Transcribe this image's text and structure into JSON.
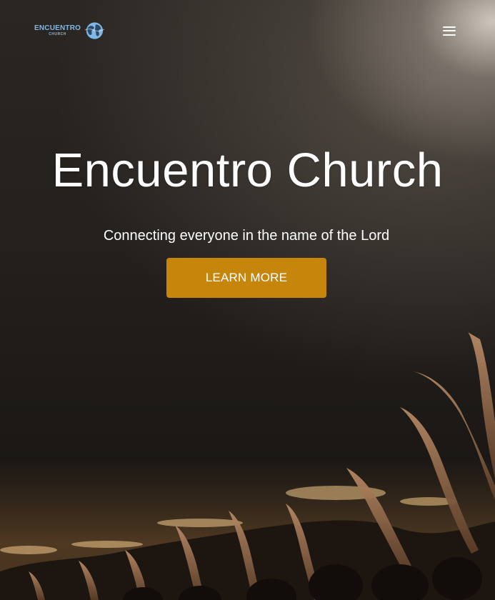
{
  "header": {
    "logo": {
      "main_text": "ENCUENTRO",
      "sub_text": "CHURCH",
      "icon": "globe-icon",
      "color": "#7fb7e6"
    },
    "menu_icon": "hamburger-menu-icon"
  },
  "hero": {
    "title": "Encuentro Church",
    "subtitle": "Connecting everyone in the name of the Lord",
    "cta_label": "LEARN MORE",
    "cta_color": "#c6860b",
    "background": "photo of a worship crowd with raised hands under a spotlight"
  }
}
